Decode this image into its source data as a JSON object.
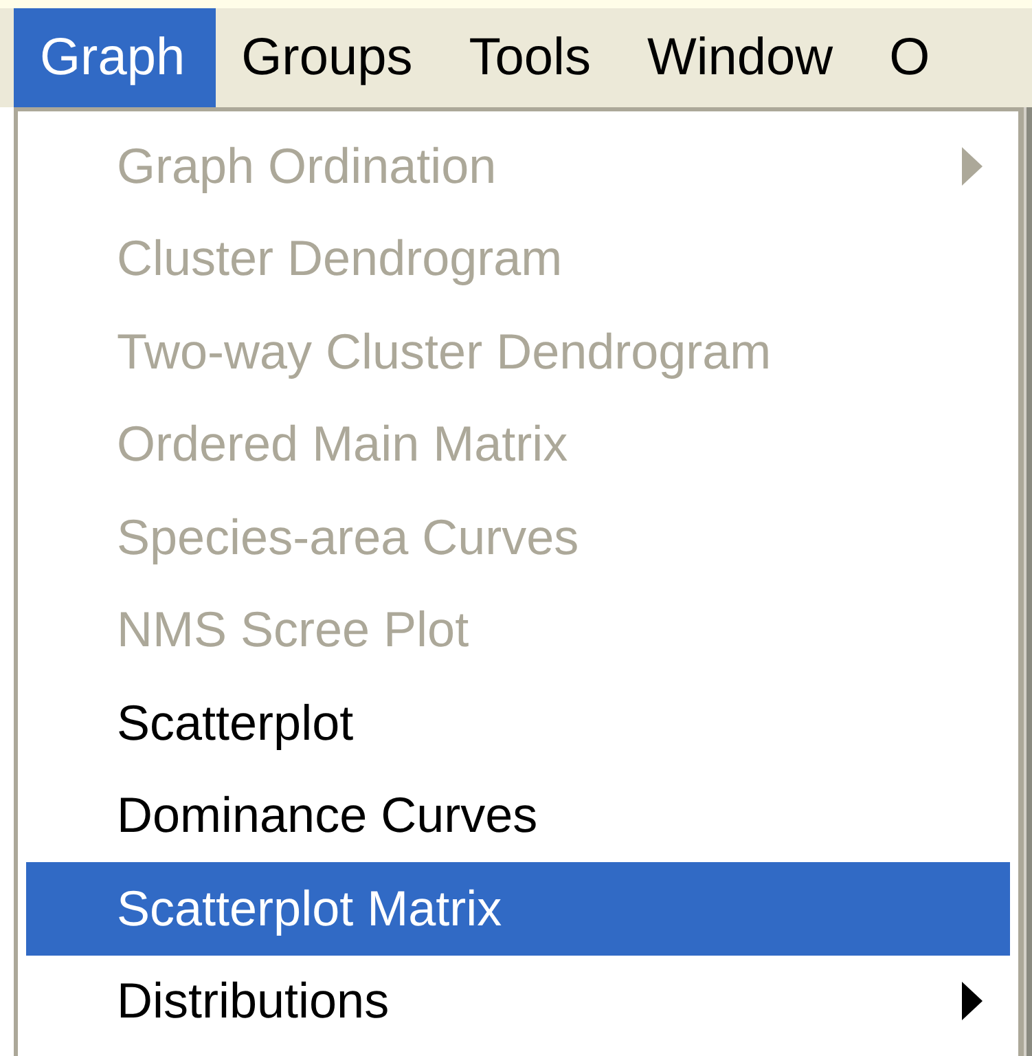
{
  "menu_bar": [
    {
      "label": "Graph",
      "selected": true
    },
    {
      "label": "Groups",
      "selected": false
    },
    {
      "label": "Tools",
      "selected": false
    },
    {
      "label": "Window",
      "selected": false
    },
    {
      "label": "O",
      "selected": false
    }
  ],
  "menu": {
    "items": [
      {
        "label": "Graph Ordination",
        "disabled": true,
        "submenu": true,
        "selected": false
      },
      {
        "label": "Cluster Dendrogram",
        "disabled": true,
        "submenu": false,
        "selected": false
      },
      {
        "label": "Two-way Cluster Dendrogram",
        "disabled": true,
        "submenu": false,
        "selected": false
      },
      {
        "label": "Ordered Main Matrix",
        "disabled": true,
        "submenu": false,
        "selected": false
      },
      {
        "label": "Species-area Curves",
        "disabled": true,
        "submenu": false,
        "selected": false
      },
      {
        "label": "NMS Scree Plot",
        "disabled": true,
        "submenu": false,
        "selected": false
      },
      {
        "label": "Scatterplot",
        "disabled": false,
        "submenu": false,
        "selected": false
      },
      {
        "label": "Dominance Curves",
        "disabled": false,
        "submenu": false,
        "selected": false
      },
      {
        "label": "Scatterplot Matrix",
        "disabled": false,
        "submenu": false,
        "selected": true
      },
      {
        "label": "Distributions",
        "disabled": false,
        "submenu": true,
        "selected": false
      }
    ]
  }
}
